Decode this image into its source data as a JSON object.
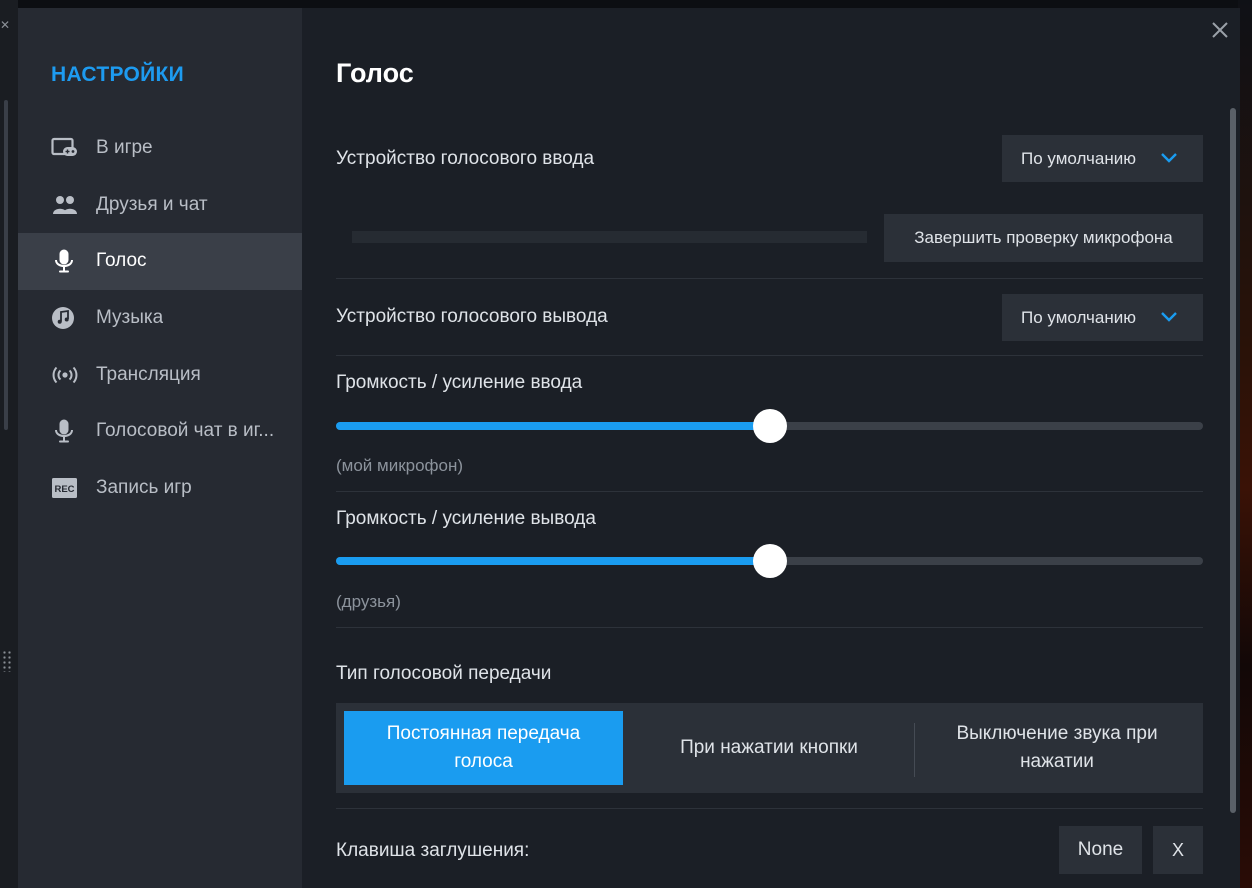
{
  "sidebar": {
    "title": "НАСТРОЙКИ",
    "items": [
      {
        "label": "В игре",
        "icon": "gamepad-window-icon"
      },
      {
        "label": "Друзья и чат",
        "icon": "friends-icon"
      },
      {
        "label": "Голос",
        "icon": "microphone-icon",
        "active": true
      },
      {
        "label": "Музыка",
        "icon": "music-note-icon"
      },
      {
        "label": "Трансляция",
        "icon": "broadcast-icon"
      },
      {
        "label": "Голосовой чат в иг...",
        "icon": "microphone-icon"
      },
      {
        "label": "Запись игр",
        "icon": "rec-icon"
      }
    ]
  },
  "page": {
    "title": "Голос"
  },
  "voice_input": {
    "label": "Устройство голосового ввода",
    "value": "По умолчанию"
  },
  "mic_test": {
    "button_label": "Завершить проверку микрофона"
  },
  "voice_output": {
    "label": "Устройство голосового вывода",
    "value": "По умолчанию"
  },
  "input_volume": {
    "label": "Громкость / усиление ввода",
    "sublabel": "(мой микрофон)",
    "level_percent": 50
  },
  "output_volume": {
    "label": "Громкость / усиление вывода",
    "sublabel": "(друзья)",
    "level_percent": 50
  },
  "transmission": {
    "label": "Тип голосовой передачи",
    "options": [
      {
        "label": "Постоянная передача голоса",
        "active": true
      },
      {
        "label": "При нажатии кнопки",
        "active": false
      },
      {
        "label": "Выключение звука при нажатии",
        "active": false
      }
    ]
  },
  "mute_key": {
    "label": "Клавиша заглушения:",
    "value": "None",
    "clear_label": "X"
  },
  "colors": {
    "accent": "#1a9cf0",
    "sidebar_bg": "#262a32",
    "content_bg": "#1b1f26"
  }
}
